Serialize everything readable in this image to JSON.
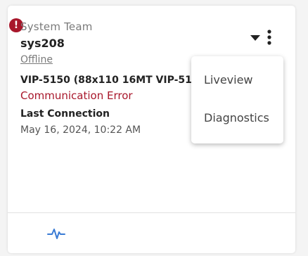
{
  "card": {
    "team": "System Team",
    "system_name": "sys208",
    "status_link": "Offline",
    "model": "VIP-5150 (88x110 16MT VIP-5150",
    "error_text": "Communication Error",
    "last_connection_label": "Last Connection",
    "last_connection_value": "May 16, 2024, 10:22 AM",
    "alert_glyph": "!"
  },
  "menu": {
    "items": [
      {
        "label": "Liveview"
      },
      {
        "label": "Diagnostics"
      }
    ]
  },
  "icons": {
    "alert": "exclamation-circle-icon",
    "caret": "caret-down-icon",
    "kebab": "kebab-menu-icon",
    "pulse": "activity-pulse-icon"
  },
  "colors": {
    "error": "#a8172b",
    "pulse": "#3a7bd5",
    "text_dark": "#222222",
    "text_muted": "#7a7a7a"
  }
}
